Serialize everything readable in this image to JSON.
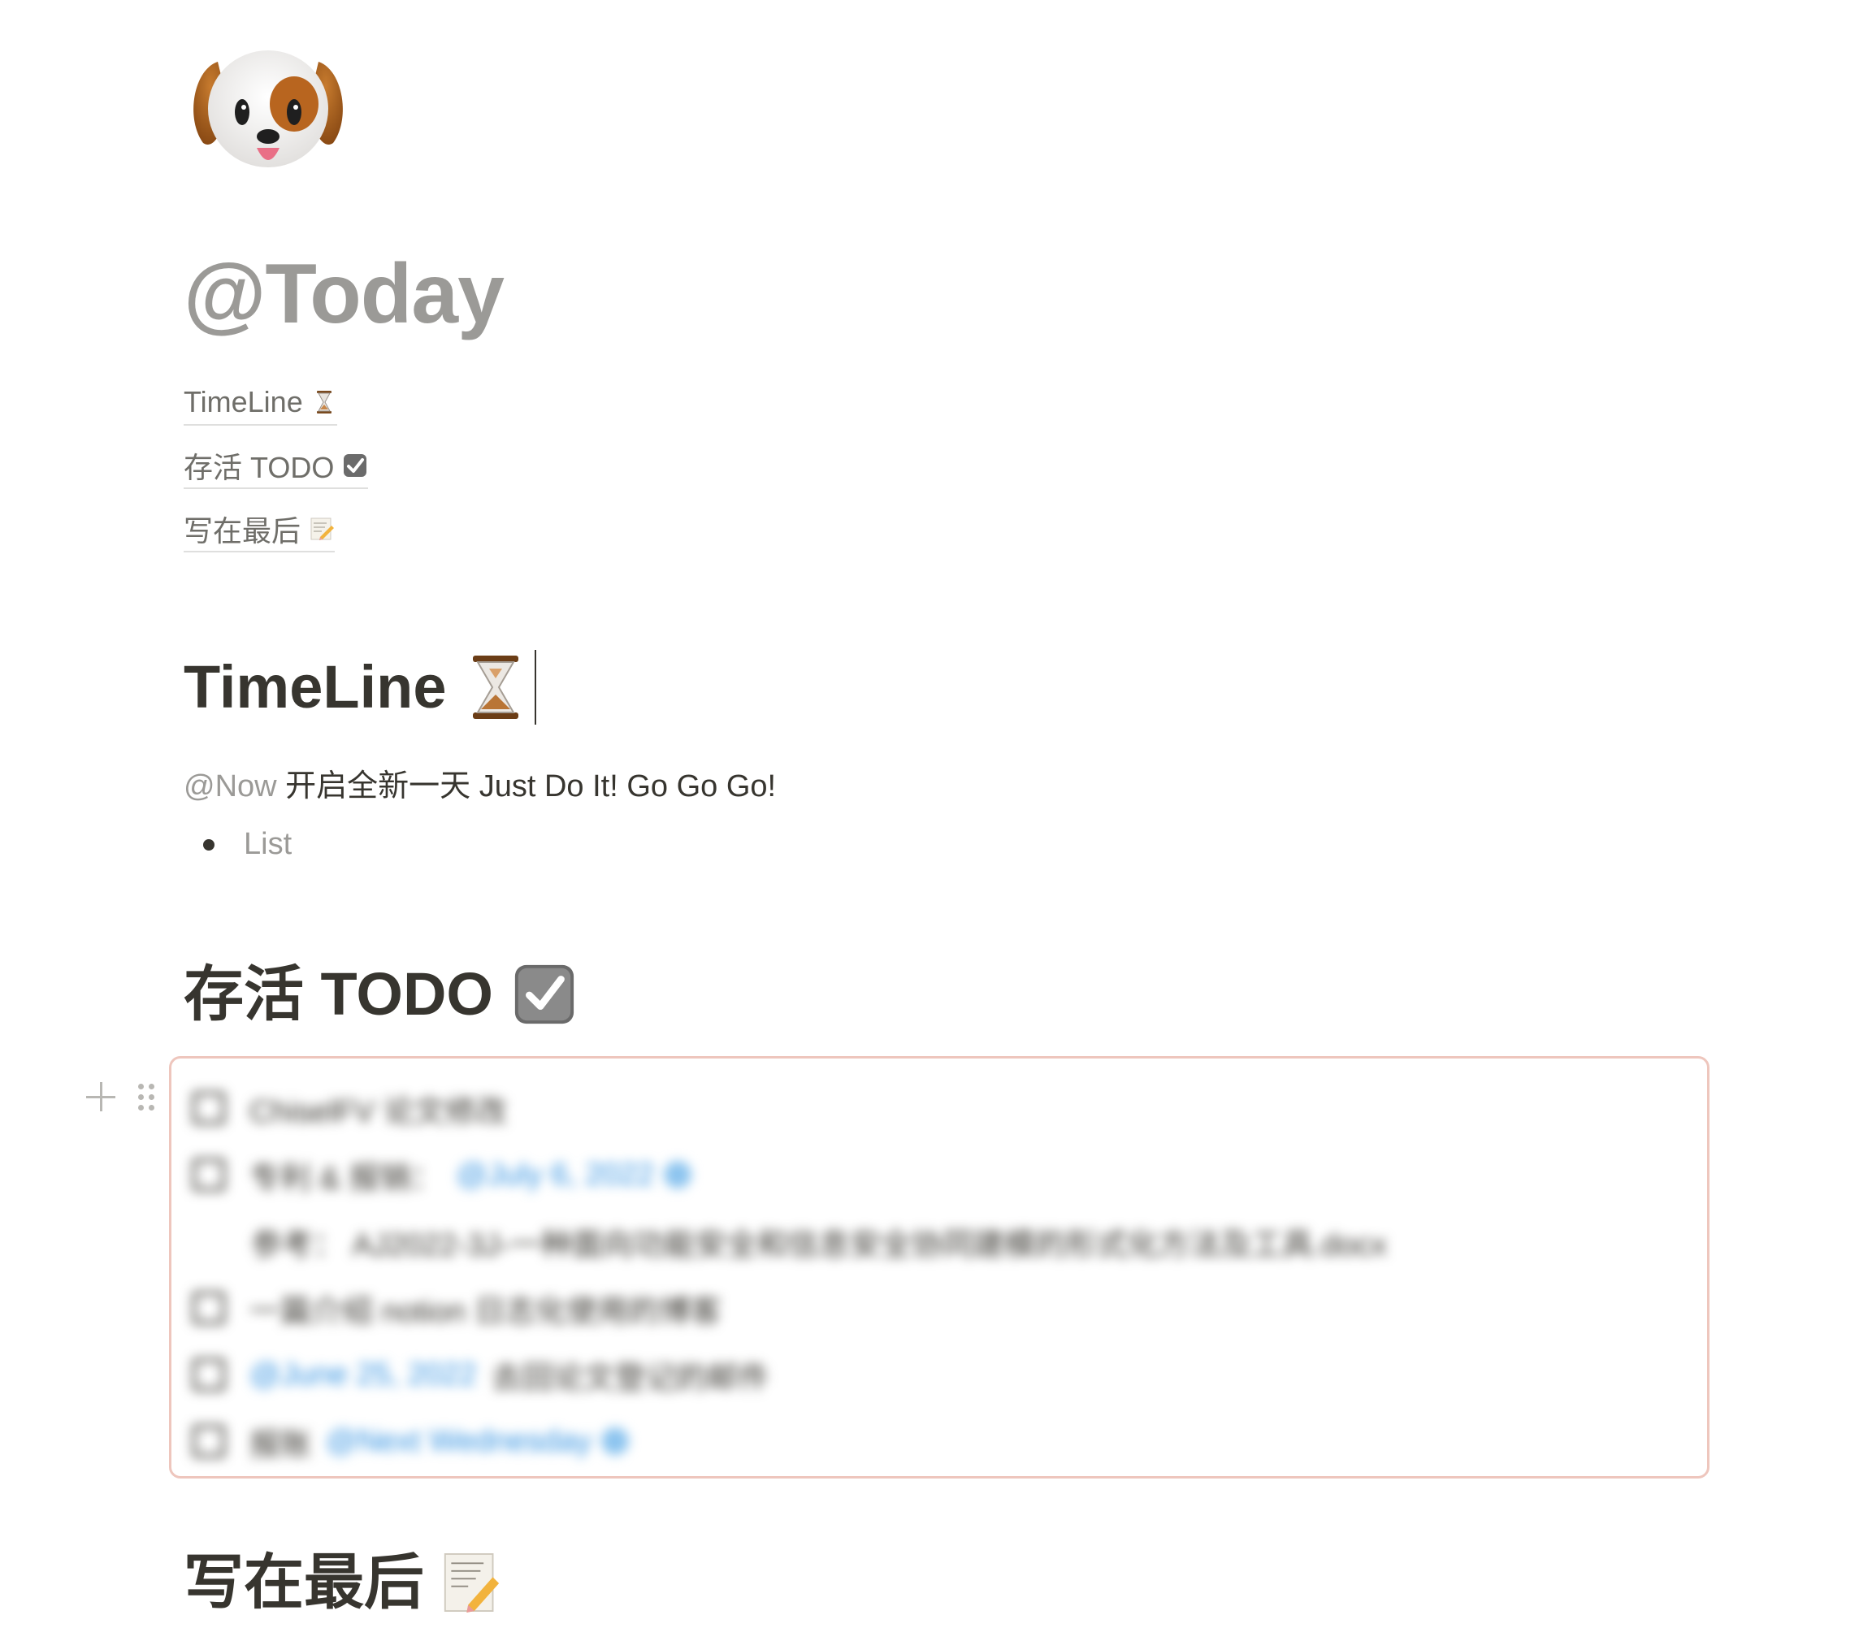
{
  "page": {
    "icon": "dog-face-icon",
    "title": "@Today"
  },
  "toc": [
    {
      "label": "TimeLine",
      "icon": "hourglass-icon"
    },
    {
      "label": "存活 TODO",
      "icon": "check-box-icon"
    },
    {
      "label": "写在最后",
      "icon": "memo-icon"
    }
  ],
  "timeline": {
    "heading": "TimeLine",
    "icon": "hourglass-icon",
    "mention": "@Now",
    "text": " 开启全新一天 Just Do It! Go Go Go!",
    "bullet": "List"
  },
  "todo": {
    "heading": "存活 TODO",
    "icon": "check-box-icon",
    "items": [
      {
        "text": "ChiselFV 论文修改"
      },
      {
        "text": "专利 & 报销：",
        "date": "@July 6, 2022"
      },
      {
        "text": "参考：  AJ2022-3J-一种面向功能安全和信息安全协同建模的形式化方法及工具.docx"
      },
      {
        "text": "一篇介绍 notion 日志化使用的博客"
      },
      {
        "date": "@June 25, 2022",
        "text": "去回论文登记的邮件"
      },
      {
        "text": "报账",
        "date": "@Next Wednesday"
      }
    ]
  },
  "closing": {
    "heading": "写在最后",
    "icon": "memo-icon"
  },
  "colors": {
    "text": "#37352f",
    "muted": "#9b9a97",
    "selection_border": "#eec6bd",
    "date_blue": "#2e8fe0"
  }
}
